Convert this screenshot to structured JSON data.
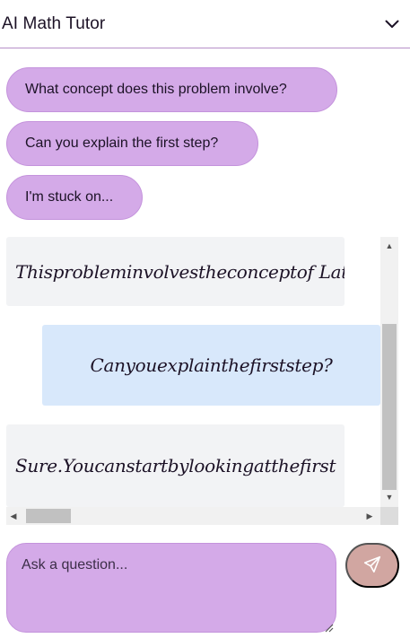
{
  "header": {
    "title": "AI Math Tutor",
    "toggle_icon": "chevron-down-icon"
  },
  "suggestions": [
    "What concept does this problem involve?",
    "Can you explain the first step?",
    "I'm stuck on..."
  ],
  "messages": [
    {
      "role": "ai",
      "text": "Thisprobleminvolvestheconceptof Lat"
    },
    {
      "role": "user",
      "text": "Canyouexplainthefirststep?"
    },
    {
      "role": "ai",
      "text": "Sure.Youcanstartbylookingatthefirst"
    }
  ],
  "composer": {
    "placeholder": "Ask a question...",
    "send_icon": "paper-plane-icon"
  },
  "colors": {
    "accent": "#d4aae8",
    "send_button": "#d1a6a1",
    "user_bubble": "#d8e8fb",
    "ai_bubble": "#f2f3f5",
    "header_border": "#b690c9"
  }
}
